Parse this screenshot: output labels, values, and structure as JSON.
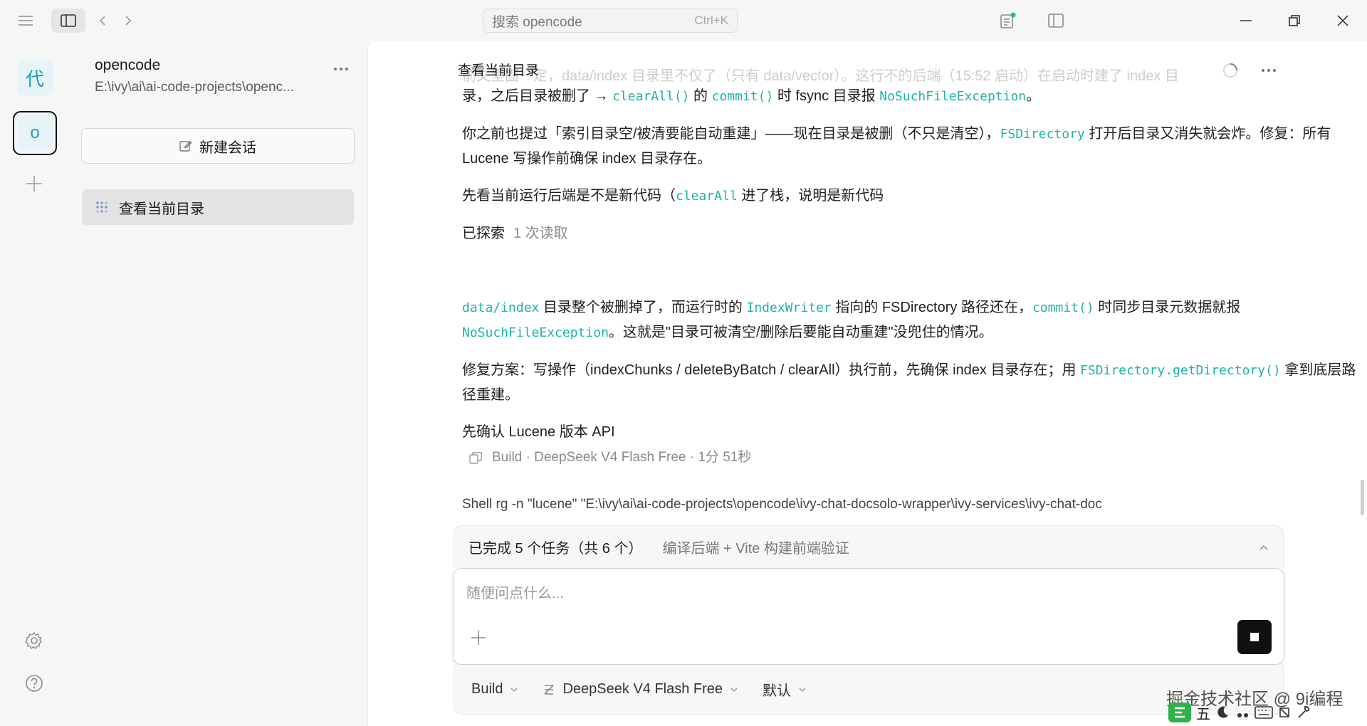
{
  "search": {
    "placeholder": "搜索 opencode",
    "shortcut": "Ctrl+K"
  },
  "rail": {
    "workspace_active": "代",
    "workspace_second": "o"
  },
  "sidebar": {
    "project_name": "opencode",
    "project_path": "E:\\ivy\\ai\\ai-code-projects\\openc...",
    "new_session_label": "新建会话",
    "sessions": [
      {
        "label": "查看当前目录"
      }
    ]
  },
  "main": {
    "title": "查看当前目录",
    "faded_line": "前文里面一定，data/index 目录里不仅了（只有 data/vector）。这行不的后端（15:52 启动）在启动时建了 index 目",
    "p1": {
      "t1": "录，之后目录被删了 → ",
      "c1": "clearAll()",
      "t2": " 的 ",
      "c2": "commit()",
      "t3": " 时 fsync 目录报 ",
      "c3": "NoSuchFileException",
      "t4": "。"
    },
    "p2": {
      "t1": "你之前也提过「索引目录空/被清要能自动重建」——现在目录是被删（不只是清空），",
      "c1": "FSDirectory",
      "t2": " 打开后目录又消失就会炸。修复：所有 Lucene 写操作前确保 index 目录存在。"
    },
    "p3": {
      "t1": "先看当前运行后端是不是新代码（",
      "c1": "clearAll",
      "t2": " 进了栈，说明是新代码"
    },
    "explored": {
      "label": "已探索",
      "detail": "1 次读取"
    },
    "p4": {
      "c1": "data/index",
      "t1": " 目录整个被删掉了，而运行时的 ",
      "c2": "IndexWriter",
      "t2": " 指向的 FSDirectory 路径还在，",
      "c3": "commit()",
      "t3": " 时同步目录元数据就报 ",
      "c4": "NoSuchFileException",
      "t4": "。这就是\"目录可被清空/删除后要能自动重建\"没兜住的情况。"
    },
    "p5": {
      "t1": "修复方案：写操作（indexChunks / deleteByBatch / clearAll）执行前，先确保 index 目录存在；用 ",
      "c1": "FSDirectory.getDirectory()",
      "t2": " 拿到底层路径重建。"
    },
    "p6": "先确认 Lucene 版本 API",
    "meta": "Build · DeepSeek V4 Flash Free · 1分 51秒",
    "shell": "Shell  rg -n \"lucene\" \"E:\\ivy\\ai\\ai-code-projects\\opencode\\ivy-chat-docsolo-wrapper\\ivy-services\\ivy-chat-doc"
  },
  "todo": {
    "summary": "已完成 5 个任务（共 6 个）",
    "current": "编译后端 + Vite 构建前端验证"
  },
  "composer": {
    "placeholder": "随便问点什么..."
  },
  "bottom": {
    "agent": "Build",
    "model": "DeepSeek V4 Flash Free",
    "variant": "默认"
  },
  "watermark": "掘金技术社区 @ 9i编程",
  "ime": {
    "label": "五"
  },
  "colors": {
    "code": "#1bb5a5",
    "active_ws_bg": "#e6f4f8",
    "status_dot": "#22c55e"
  }
}
